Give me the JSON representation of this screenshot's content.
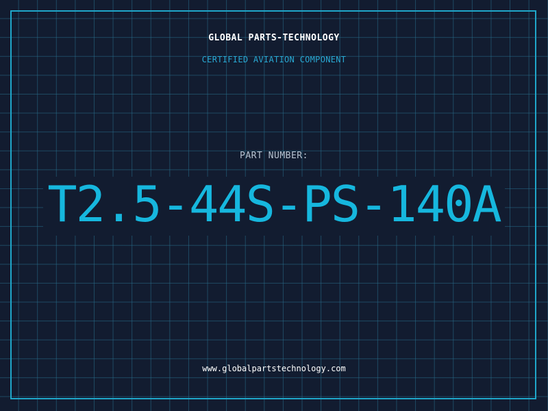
{
  "header": {
    "company": "GLOBAL PARTS-TECHNOLOGY",
    "subtitle": "CERTIFIED AVIATION COMPONENT"
  },
  "part": {
    "label": "PART NUMBER:",
    "number": "T2.5-44S-PS-140A"
  },
  "footer": {
    "url": "www.globalpartstechnology.com"
  },
  "colors": {
    "background": "#121c30",
    "grid": "#286e8c",
    "frame": "#1fa6c9",
    "accent": "#16b7de"
  }
}
